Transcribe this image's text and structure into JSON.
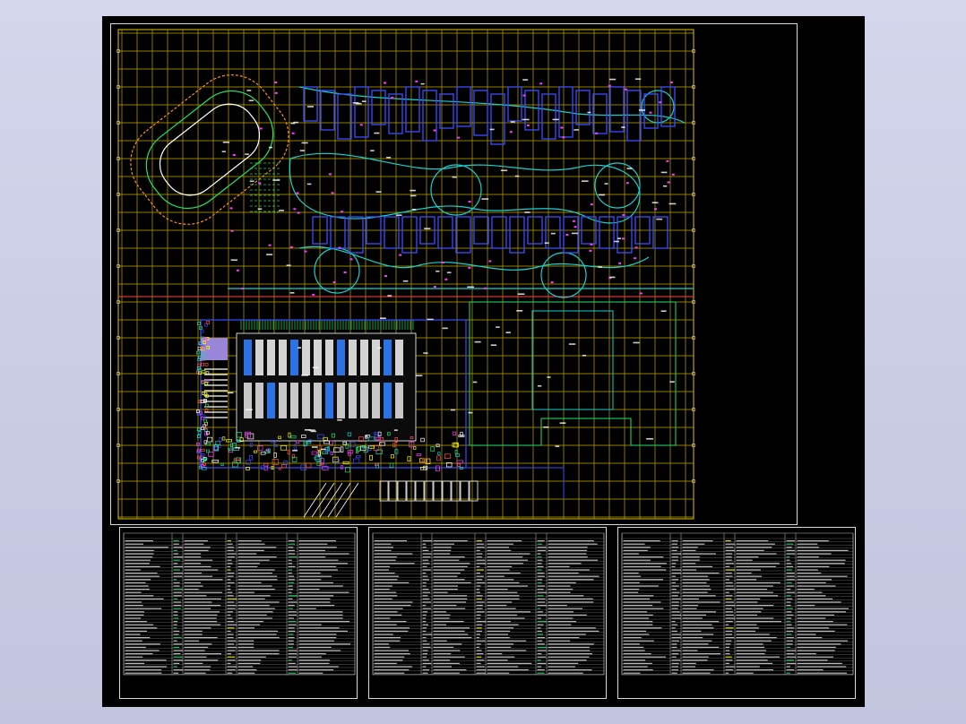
{
  "viewer": {
    "background_color": "#cccfe6",
    "canvas_color": "#000000"
  },
  "drawing": {
    "type": "site-plan",
    "layer_colors": {
      "grid": "#e0c200",
      "walls": "#3a4dff",
      "paths": "#18d0d0",
      "landscape": "#21e36b",
      "annotation": "#ff3cff",
      "text": "#ffffff",
      "hatch": "#ff8c1a"
    }
  },
  "sheets": [
    {
      "id": "sheet-1",
      "title": ""
    },
    {
      "id": "sheet-2",
      "title": ""
    },
    {
      "id": "sheet-3",
      "title": ""
    }
  ]
}
